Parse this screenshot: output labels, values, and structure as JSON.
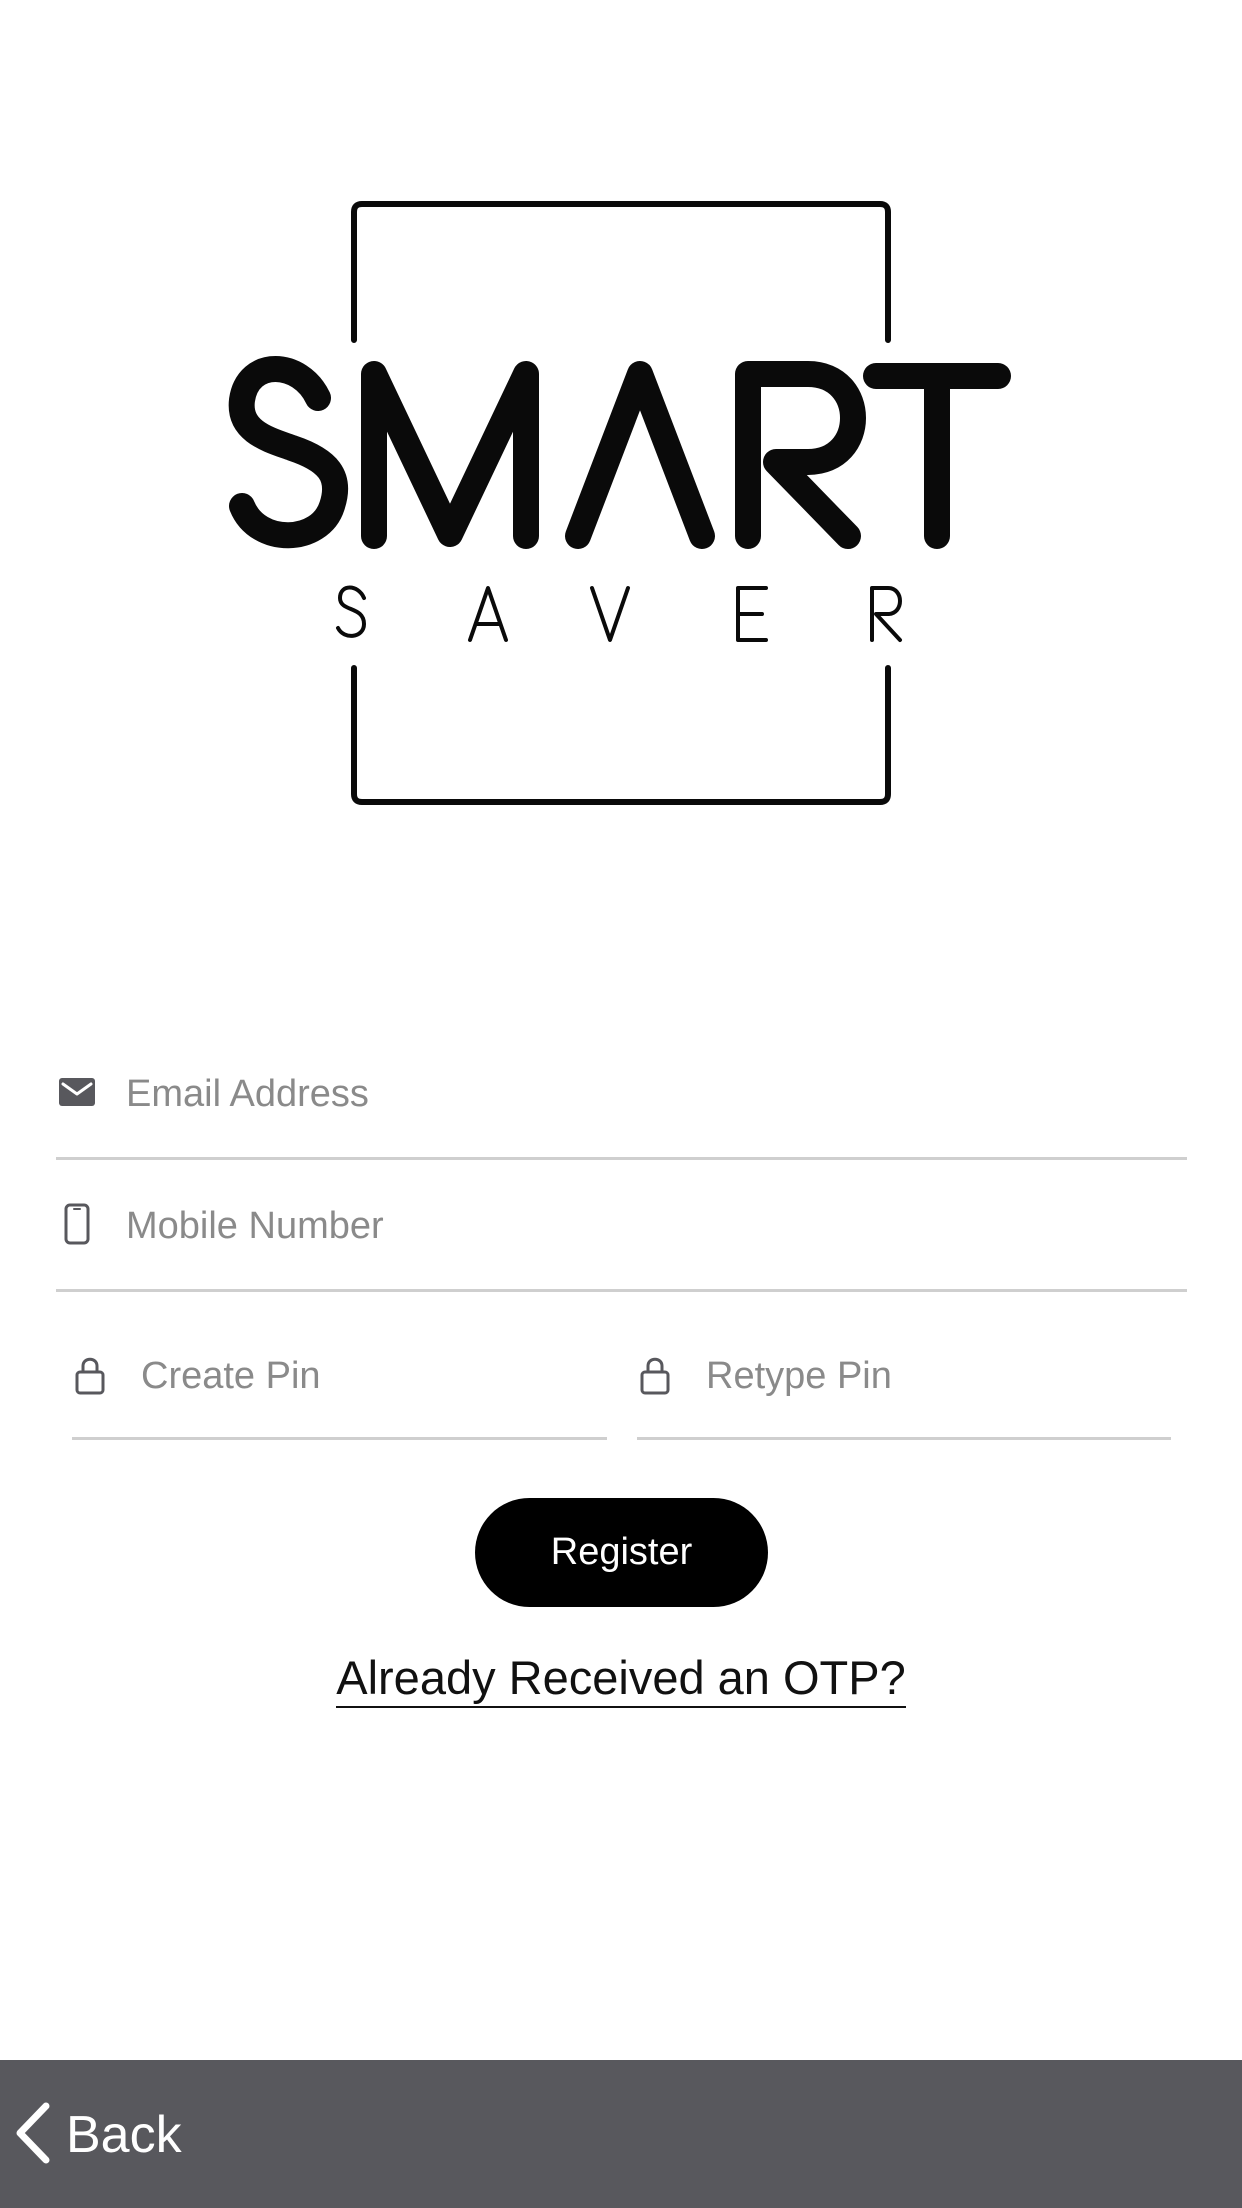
{
  "logo": {
    "word_primary": "SMART",
    "word_secondary": "SAVER",
    "color": "#0a0a0a"
  },
  "form": {
    "email": {
      "placeholder": "Email Address",
      "value": "",
      "icon": "envelope-icon"
    },
    "mobile": {
      "placeholder": "Mobile Number",
      "value": "",
      "icon": "smartphone-icon"
    },
    "create_pin": {
      "placeholder": "Create Pin",
      "value": "",
      "icon": "lock-icon"
    },
    "retype_pin": {
      "placeholder": "Retype Pin",
      "value": "",
      "icon": "lock-icon"
    }
  },
  "actions": {
    "register_label": "Register",
    "otp_link_label": "Already Received an OTP?"
  },
  "bottom_bar": {
    "back_label": "Back",
    "back_icon": "chevron-left-icon",
    "background": "#58585d"
  },
  "colors": {
    "button_bg": "#000000",
    "button_text": "#ffffff",
    "placeholder": "#8a8a8a",
    "divider": "#cfcfcf"
  }
}
